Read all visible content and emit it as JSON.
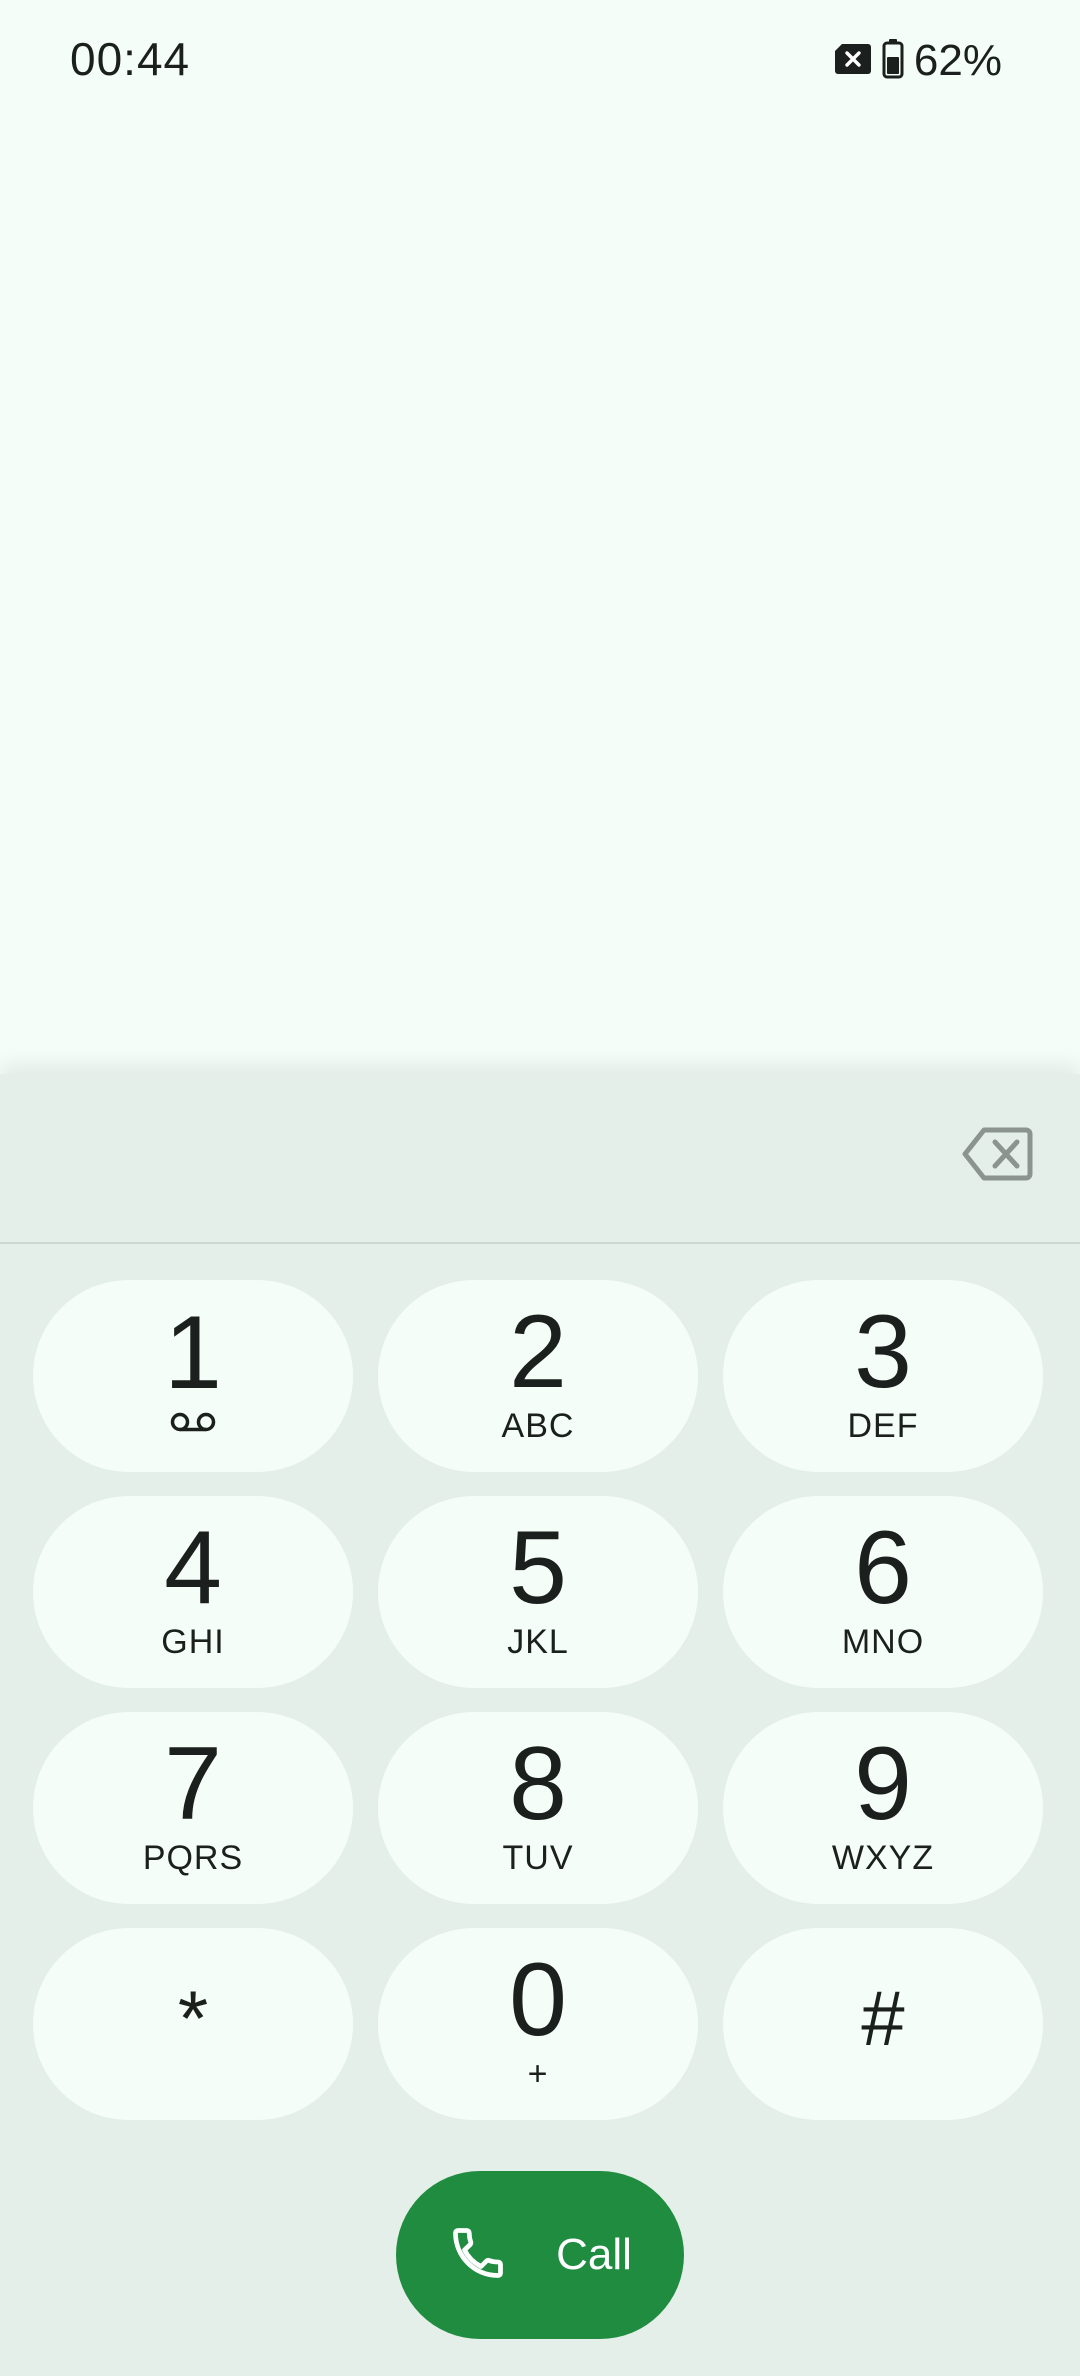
{
  "status_bar": {
    "time": "00:44",
    "battery_percent": "62%",
    "battery_level": 0.62,
    "icons": [
      "no-sim-icon",
      "battery-icon"
    ]
  },
  "dialer": {
    "entered_digits": "",
    "backspace_icon": "backspace-icon",
    "keys": [
      {
        "digit": "1",
        "letters": "",
        "icon": "voicemail-icon"
      },
      {
        "digit": "2",
        "letters": "ABC"
      },
      {
        "digit": "3",
        "letters": "DEF"
      },
      {
        "digit": "4",
        "letters": "GHI"
      },
      {
        "digit": "5",
        "letters": "JKL"
      },
      {
        "digit": "6",
        "letters": "MNO"
      },
      {
        "digit": "7",
        "letters": "PQRS"
      },
      {
        "digit": "8",
        "letters": "TUV"
      },
      {
        "digit": "9",
        "letters": "WXYZ"
      },
      {
        "digit": "*",
        "letters": ""
      },
      {
        "digit": "0",
        "letters": "+"
      },
      {
        "digit": "#",
        "letters": ""
      }
    ],
    "call_button": {
      "label": "Call",
      "icon": "phone-icon",
      "color": "#1f8c40"
    }
  },
  "colors": {
    "background": "#f5fdf8",
    "dialpad_sheet": "#e4efe9",
    "key_background": "#f5fdf8",
    "accent": "#1f8c40"
  }
}
